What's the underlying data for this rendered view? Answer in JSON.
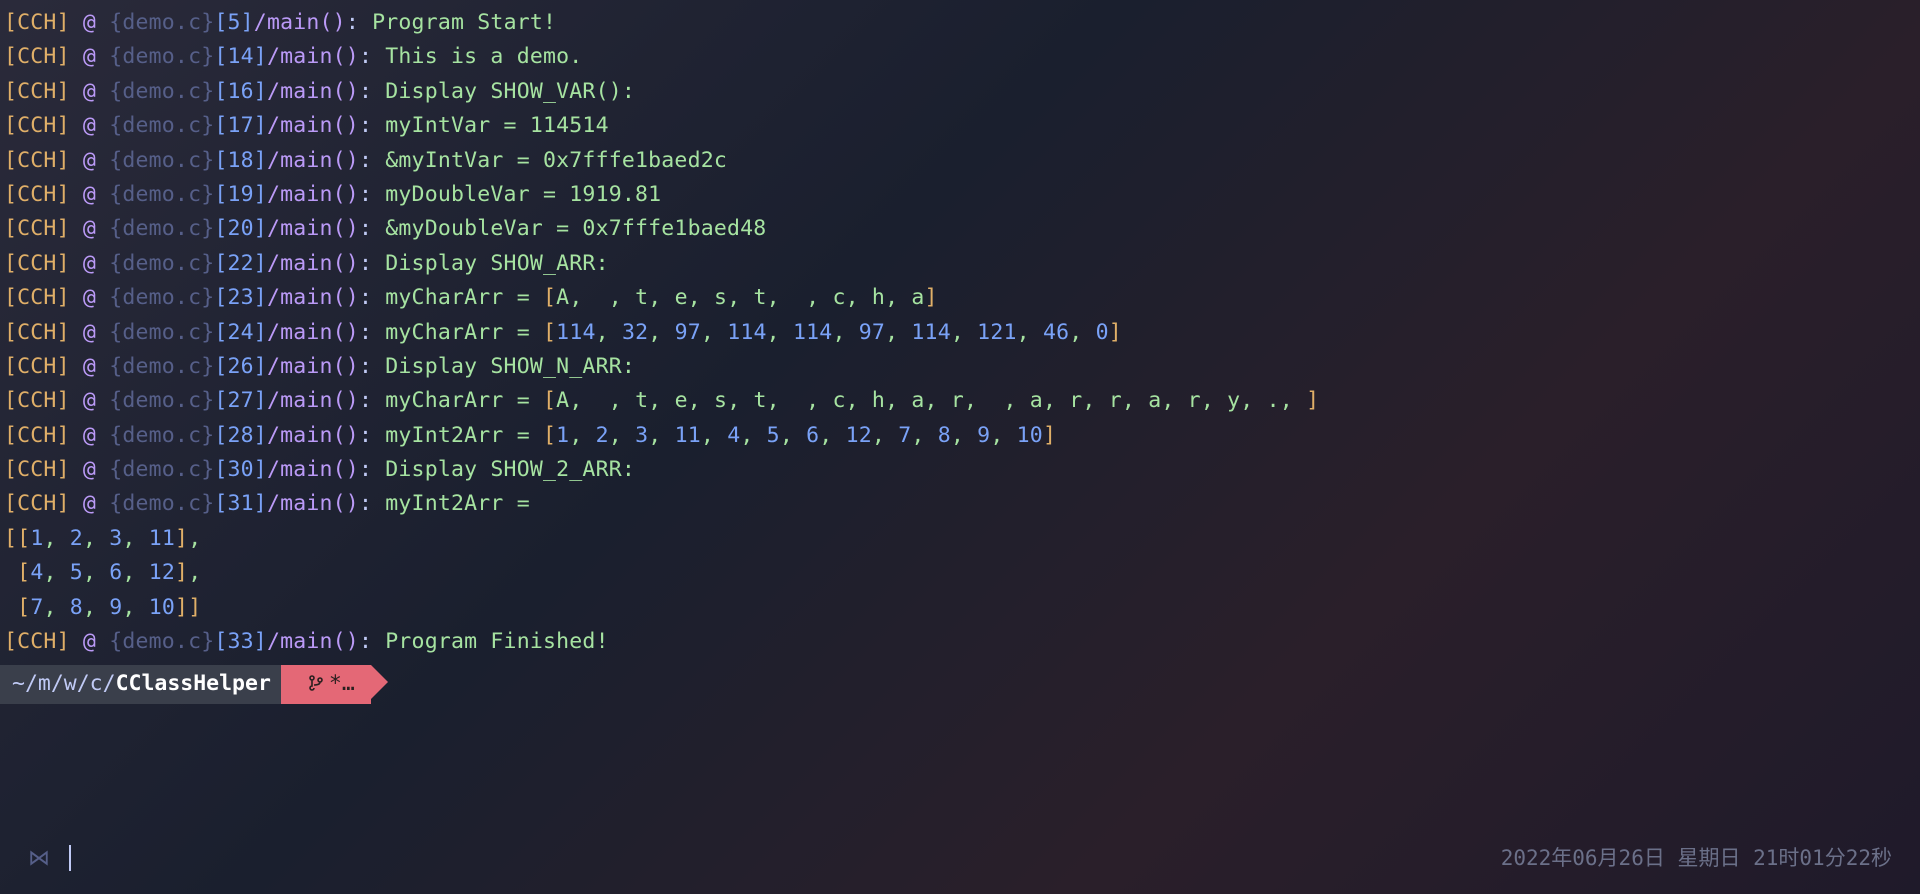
{
  "log": {
    "tag": "[CCH]",
    "at": "@",
    "file": "{demo.c}",
    "fn": "/main()",
    "lines": [
      {
        "ln": "[5]",
        "msg": "Program Start!"
      },
      {
        "ln": "[14]",
        "msg": "This is a demo."
      },
      {
        "ln": "[16]",
        "msg": "Display SHOW_VAR():"
      },
      {
        "ln": "[17]",
        "msg": "myIntVar = 114514"
      },
      {
        "ln": "[18]",
        "msg": "&myIntVar = 0x7fffe1baed2c"
      },
      {
        "ln": "[19]",
        "msg": "myDoubleVar = 1919.81"
      },
      {
        "ln": "[20]",
        "msg": "&myDoubleVar = 0x7fffe1baed48"
      },
      {
        "ln": "[22]",
        "msg": "Display SHOW_ARR:"
      },
      {
        "ln": "[23]",
        "msg_pre": "myCharArr = ",
        "arr": "[A,  , t, e, s, t,  , c, h, a]"
      },
      {
        "ln": "[24]",
        "msg_pre": "myCharArr = ",
        "arr": "[114, 32, 97, 114, 114, 97, 114, 121, 46, 0]"
      },
      {
        "ln": "[26]",
        "msg": "Display SHOW_N_ARR:"
      },
      {
        "ln": "[27]",
        "msg_pre": "myCharArr = ",
        "arr": "[A,  , t, e, s, t,  , c, h, a, r,  , a, r, r, a, r, y, ., ]"
      },
      {
        "ln": "[28]",
        "msg_pre": "myInt2Arr = ",
        "arr": "[1, 2, 3, 11, 4, 5, 6, 12, 7, 8, 9, 10]"
      },
      {
        "ln": "[30]",
        "msg": "Display SHOW_2_ARR:"
      },
      {
        "ln": "[31]",
        "msg": "myInt2Arr ="
      }
    ],
    "matrix": [
      "[[1, 2, 3, 11],",
      " [4, 5, 6, 12],",
      " [7, 8, 9, 10]]"
    ],
    "final": {
      "ln": "[33]",
      "msg": "Program Finished!"
    }
  },
  "prompt": {
    "cwd_prefix": "~/m/w/c/",
    "cwd_name": "CClassHelper",
    "git_status": "*…"
  },
  "status": {
    "datetime": "2022年06月26日  星期日  21时01分22秒"
  }
}
